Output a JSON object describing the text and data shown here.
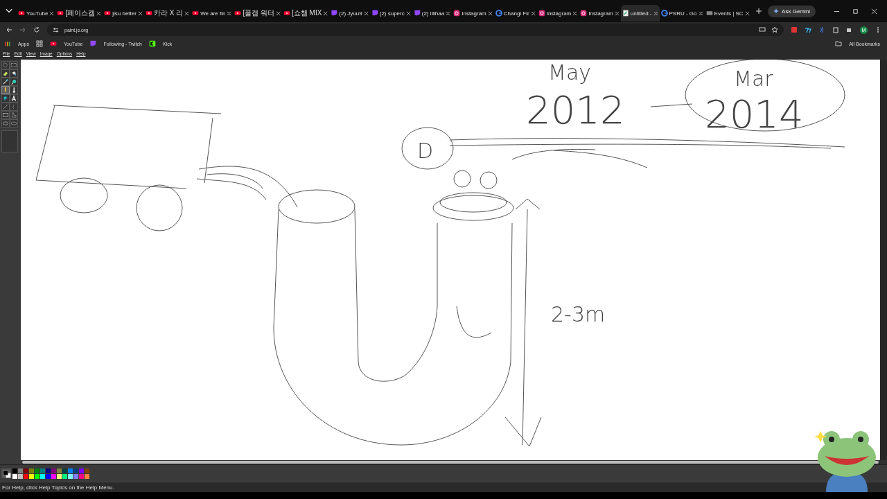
{
  "browser": {
    "tabs": [
      {
        "label": "YouTube",
        "kind": "youtube",
        "selected": false
      },
      {
        "label": "[페이스캠",
        "kind": "youtube",
        "selected": false
      },
      {
        "label": "jisu better",
        "kind": "youtube",
        "selected": false
      },
      {
        "label": "카라 X 리",
        "kind": "youtube",
        "selected": false
      },
      {
        "label": "We are fin",
        "kind": "youtube",
        "selected": false
      },
      {
        "label": "[풀캠 워터",
        "kind": "youtube",
        "selected": false
      },
      {
        "label": "[쇼챔 MIX",
        "kind": "youtube",
        "selected": false
      },
      {
        "label": "(2) Jyuu9",
        "kind": "twitch",
        "selected": false
      },
      {
        "label": "(2) superc",
        "kind": "twitch",
        "selected": false
      },
      {
        "label": "(2) lilihaa",
        "kind": "twitch",
        "selected": false
      },
      {
        "label": "Instagram",
        "kind": "instagram",
        "selected": false
      },
      {
        "label": "Changi Fir",
        "kind": "google",
        "selected": false
      },
      {
        "label": "Instagram",
        "kind": "instagram",
        "selected": false
      },
      {
        "label": "Instagram",
        "kind": "instagram",
        "selected": false
      },
      {
        "label": "untitled -",
        "kind": "paint",
        "selected": true
      },
      {
        "label": "PSRU - Go",
        "kind": "google",
        "selected": false
      },
      {
        "label": "Events | SC",
        "kind": "page",
        "selected": false
      }
    ],
    "ask_button": "Ask Gemini",
    "address": "paint.js.org",
    "profile_initial": "M",
    "bookmarks": [
      {
        "label": "Apps",
        "kind": "apps"
      },
      {
        "label": "YouTube",
        "kind": "youtube"
      },
      {
        "label": "Following - Twitch",
        "kind": "twitch"
      },
      {
        "label": "Kick",
        "kind": "kick"
      }
    ],
    "all_bookmarks": "All Bookmarks"
  },
  "paint": {
    "menu": [
      "File",
      "Edit",
      "View",
      "Image",
      "Options",
      "Help"
    ],
    "tools": [
      {
        "kind": "free-select",
        "selected": false
      },
      {
        "kind": "select",
        "selected": false
      },
      {
        "kind": "eraser",
        "selected": false
      },
      {
        "kind": "fill",
        "selected": false
      },
      {
        "kind": "picker",
        "selected": false
      },
      {
        "kind": "magnifier",
        "selected": false
      },
      {
        "kind": "pencil",
        "selected": true
      },
      {
        "kind": "brush",
        "selected": false
      },
      {
        "kind": "airbrush",
        "selected": false
      },
      {
        "kind": "text",
        "selected": false
      },
      {
        "kind": "line",
        "selected": false
      },
      {
        "kind": "curve",
        "selected": false
      },
      {
        "kind": "rectangle",
        "selected": false
      },
      {
        "kind": "polygon",
        "selected": false
      },
      {
        "kind": "ellipse",
        "selected": false
      },
      {
        "kind": "rounded-rectangle",
        "selected": false
      }
    ],
    "canvas_labels": [
      "May",
      "2012",
      "Mar",
      "2014",
      "D",
      "2-3m"
    ],
    "palette": [
      {
        "color": "#000000"
      },
      {
        "color": "#808080"
      },
      {
        "color": "#800000"
      },
      {
        "color": "#808000"
      },
      {
        "color": "#008000"
      },
      {
        "color": "#008080"
      },
      {
        "color": "#000080"
      },
      {
        "color": "#800080"
      },
      {
        "color": "#808040"
      },
      {
        "color": "#004040"
      },
      {
        "color": "#0080ff"
      },
      {
        "color": "#004080"
      },
      {
        "color": "#8000ff"
      },
      {
        "color": "#804000"
      },
      {
        "color": "#ffffff"
      },
      {
        "color": "#c0c0c0"
      },
      {
        "color": "#ff0000"
      },
      {
        "color": "#ffff00"
      },
      {
        "color": "#00ff00"
      },
      {
        "color": "#00ffff"
      },
      {
        "color": "#0000ff"
      },
      {
        "color": "#ff00ff"
      },
      {
        "color": "#ffff80"
      },
      {
        "color": "#00ff80"
      },
      {
        "color": "#80ffff"
      },
      {
        "color": "#8080ff"
      },
      {
        "color": "#ff0080"
      },
      {
        "color": "#ff8040"
      }
    ],
    "status": "For Help, click Help Topics on the Help Menu."
  }
}
